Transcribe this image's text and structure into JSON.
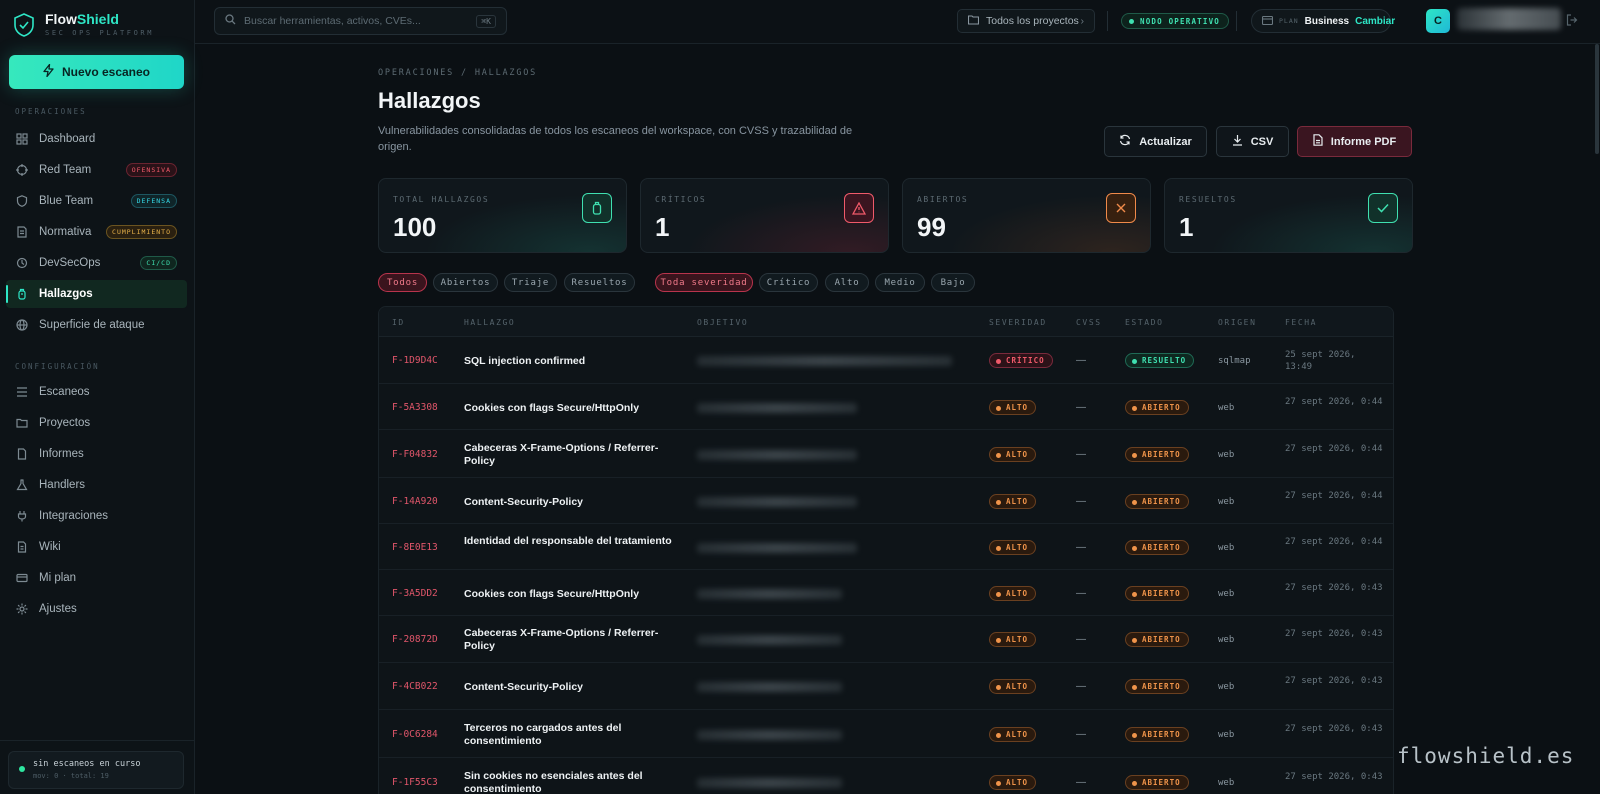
{
  "brand": {
    "name_main": "Flow",
    "name_accent": "Shield",
    "subtitle": "SEC OPS PLATFORM"
  },
  "sidebar": {
    "new_scan_label": "Nuevo escaneo",
    "section_operaciones": "OPERACIONES",
    "section_configuracion": "CONFIGURACIÓN",
    "operaciones": [
      {
        "label": "Dashboard",
        "icon": "grid-icon"
      },
      {
        "label": "Red Team",
        "icon": "target-icon",
        "badge": "OFENSIVA"
      },
      {
        "label": "Blue Team",
        "icon": "shield-icon",
        "badge": "DEFENSA"
      },
      {
        "label": "Normativa",
        "icon": "document-icon",
        "badge": "CUMPLIMIENTO"
      },
      {
        "label": "DevSecOps",
        "icon": "loop-icon",
        "badge": "CI/CD"
      },
      {
        "label": "Hallazgos",
        "icon": "bug-icon",
        "active": true
      },
      {
        "label": "Superficie de ataque",
        "icon": "globe-icon"
      }
    ],
    "configuracion": [
      {
        "label": "Escaneos",
        "icon": "list-icon"
      },
      {
        "label": "Proyectos",
        "icon": "folder-icon"
      },
      {
        "label": "Informes",
        "icon": "file-icon"
      },
      {
        "label": "Handlers",
        "icon": "flask-icon"
      },
      {
        "label": "Integraciones",
        "icon": "plug-icon"
      },
      {
        "label": "Wiki",
        "icon": "page-icon"
      },
      {
        "label": "Mi plan",
        "icon": "card-icon"
      },
      {
        "label": "Ajustes",
        "icon": "gear-icon"
      }
    ],
    "status_title": "sin escaneos en curso",
    "status_sub": "mov: 0 · total: 19"
  },
  "topbar": {
    "search_placeholder": "Buscar herramientas, activos, CVEs...",
    "search_kbd": "⌘K",
    "projects_label": "Todos los proyectos",
    "node_status": "NODO OPERATIVO",
    "plan_label": "PLAN",
    "plan_value": "Business",
    "plan_change": "Cambiar",
    "avatar_initial": "C"
  },
  "page": {
    "breadcrumb": "OPERACIONES / HALLAZGOS",
    "title": "Hallazgos",
    "description": "Vulnerabilidades consolidadas de todos los escaneos del workspace, con CVSS y trazabilidad de origen.",
    "actions": {
      "refresh": "Actualizar",
      "csv": "CSV",
      "pdf": "Informe PDF"
    }
  },
  "kpis": [
    {
      "label": "TOTAL HALLAZGOS",
      "value": "100",
      "icon": "bug-icon"
    },
    {
      "label": "CRÍTICOS",
      "value": "1",
      "icon": "warning-icon"
    },
    {
      "label": "ABIERTOS",
      "value": "99",
      "icon": "x-icon"
    },
    {
      "label": "RESUELTOS",
      "value": "1",
      "icon": "check-icon"
    }
  ],
  "filters": {
    "status": [
      "Todos",
      "Abiertos",
      "Triaje",
      "Resueltos"
    ],
    "severity": [
      "Toda severidad",
      "Crítico",
      "Alto",
      "Medio",
      "Bajo"
    ]
  },
  "table": {
    "headers": [
      "ID",
      "HALLAZGO",
      "OBJETIVO",
      "SEVERIDAD",
      "CVSS",
      "ESTADO",
      "ORIGEN",
      "FECHA"
    ],
    "rows": [
      {
        "id": "F-1D9D4C",
        "title": "SQL injection confirmed",
        "severity": "CRÍTICO",
        "sev": "crit",
        "cvss": "—",
        "status": "RESUELTO",
        "st": "res",
        "origin": "sqlmap",
        "date": "25 sept 2026, 13:49"
      },
      {
        "id": "F-5A3308",
        "title": "Cookies con flags Secure/HttpOnly",
        "severity": "ALTO",
        "sev": "high",
        "cvss": "—",
        "status": "ABIERTO",
        "st": "open",
        "origin": "web",
        "date": "27 sept 2026, 0:44"
      },
      {
        "id": "F-F04832",
        "title": "Cabeceras X-Frame-Options / Referrer-Policy",
        "severity": "ALTO",
        "sev": "high",
        "cvss": "—",
        "status": "ABIERTO",
        "st": "open",
        "origin": "web",
        "date": "27 sept 2026, 0:44"
      },
      {
        "id": "F-14A920",
        "title": "Content-Security-Policy",
        "severity": "ALTO",
        "sev": "high",
        "cvss": "—",
        "status": "ABIERTO",
        "st": "open",
        "origin": "web",
        "date": "27 sept 2026, 0:44"
      },
      {
        "id": "F-8E0E13",
        "title": "Identidad del responsable del tratamiento",
        "severity": "ALTO",
        "sev": "high",
        "cvss": "—",
        "status": "ABIERTO",
        "st": "open",
        "origin": "web",
        "date": "27 sept 2026, 0:44"
      },
      {
        "id": "F-3A5DD2",
        "title": "Cookies con flags Secure/HttpOnly",
        "severity": "ALTO",
        "sev": "high",
        "cvss": "—",
        "status": "ABIERTO",
        "st": "open",
        "origin": "web",
        "date": "27 sept 2026, 0:43"
      },
      {
        "id": "F-20872D",
        "title": "Cabeceras X-Frame-Options / Referrer-Policy",
        "severity": "ALTO",
        "sev": "high",
        "cvss": "—",
        "status": "ABIERTO",
        "st": "open",
        "origin": "web",
        "date": "27 sept 2026, 0:43"
      },
      {
        "id": "F-4CB022",
        "title": "Content-Security-Policy",
        "severity": "ALTO",
        "sev": "high",
        "cvss": "—",
        "status": "ABIERTO",
        "st": "open",
        "origin": "web",
        "date": "27 sept 2026, 0:43"
      },
      {
        "id": "F-0C6284",
        "title": "Terceros no cargados antes del consentimiento",
        "severity": "ALTO",
        "sev": "high",
        "cvss": "—",
        "status": "ABIERTO",
        "st": "open",
        "origin": "web",
        "date": "27 sept 2026, 0:43"
      },
      {
        "id": "F-1F55C3",
        "title": "Sin cookies no esenciales antes del consentimiento",
        "severity": "ALTO",
        "sev": "high",
        "cvss": "—",
        "status": "ABIERTO",
        "st": "open",
        "origin": "web",
        "date": "27 sept 2026, 0:43"
      }
    ]
  },
  "watermark": "flowshield.es"
}
